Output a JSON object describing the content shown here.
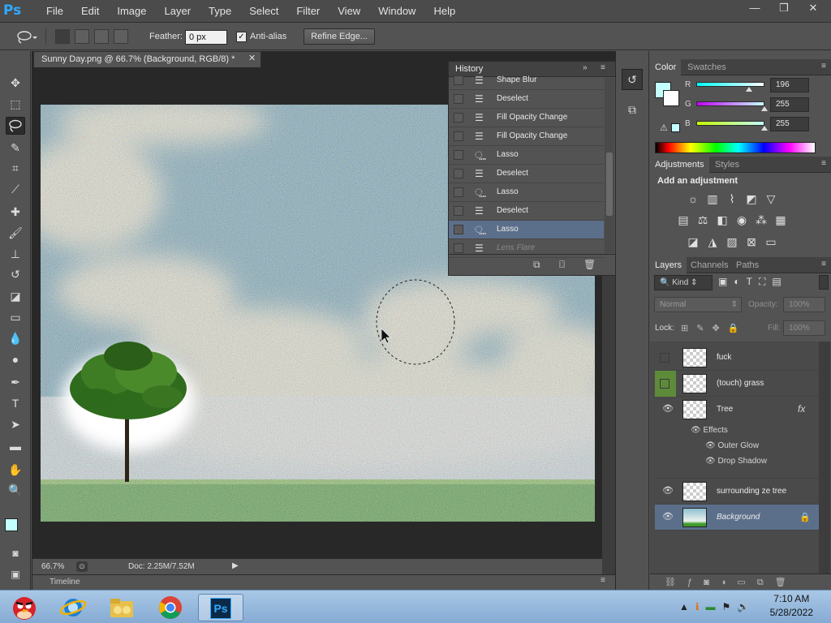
{
  "app": {
    "logo": "Ps"
  },
  "menu": [
    "File",
    "Edit",
    "Image",
    "Layer",
    "Type",
    "Select",
    "Filter",
    "View",
    "Window",
    "Help"
  ],
  "window_controls": {
    "minimize": "—",
    "restore": "❐",
    "close": "✕"
  },
  "options": {
    "feather_label": "Feather:",
    "feather_value": "0 px",
    "antialias_label": "Anti-alias",
    "antialias_checked": true,
    "refine_label": "Refine Edge..."
  },
  "document": {
    "tab_title": "Sunny Day.png @ 66.7% (Background, RGB/8) *",
    "zoom": "66.7%",
    "doc_info": "Doc: 2.25M/7.52M",
    "timeline_label": "Timeline"
  },
  "history": {
    "title": "History",
    "items": [
      {
        "label": "Shape Blur",
        "icon": "doc-icon"
      },
      {
        "label": "Deselect",
        "icon": "doc-icon"
      },
      {
        "label": "Fill Opacity Change",
        "icon": "doc-icon"
      },
      {
        "label": "Fill Opacity Change",
        "icon": "doc-icon"
      },
      {
        "label": "Lasso",
        "icon": "lasso-icon"
      },
      {
        "label": "Deselect",
        "icon": "doc-icon"
      },
      {
        "label": "Lasso",
        "icon": "lasso-icon"
      },
      {
        "label": "Deselect",
        "icon": "doc-icon"
      },
      {
        "label": "Lasso",
        "icon": "lasso-icon",
        "selected": true
      },
      {
        "label": "Lens Flare",
        "icon": "doc-icon",
        "faded": true
      }
    ]
  },
  "color_panel": {
    "tabs": [
      "Color",
      "Swatches"
    ],
    "channels": [
      {
        "name": "R",
        "value": "196",
        "fraction": 0.77
      },
      {
        "name": "G",
        "value": "255",
        "fraction": 1.0
      },
      {
        "name": "B",
        "value": "255",
        "fraction": 1.0
      }
    ],
    "foreground": "#c4ffff"
  },
  "adjustments": {
    "tabs": [
      "Adjustments",
      "Styles"
    ],
    "heading": "Add an adjustment"
  },
  "layers_panel": {
    "tabs": [
      "Layers",
      "Channels",
      "Paths"
    ],
    "kind": "Kind",
    "blend_mode": "Normal",
    "opacity_label": "Opacity:",
    "opacity_value": "100%",
    "lock_label": "Lock:",
    "fill_label": "Fill:",
    "fill_value": "100%",
    "layers": [
      {
        "name": "fuck",
        "visible": false
      },
      {
        "name": "(touch) grass",
        "visible": false,
        "highlight": true
      },
      {
        "name": "Tree",
        "visible": true,
        "fx": "fx",
        "effects_label": "Effects",
        "effects": [
          "Outer Glow",
          "Drop Shadow"
        ]
      },
      {
        "name": "surrounding ze tree",
        "visible": true
      },
      {
        "name": "Background",
        "visible": true,
        "locked": true,
        "selected": true
      }
    ]
  },
  "taskbar": {
    "time": "7:10 AM",
    "date": "5/28/2022"
  },
  "colors": {
    "accent": "#31a8ff",
    "selection": "#5c6f8a",
    "panel": "#535353",
    "dark": "#282828"
  }
}
